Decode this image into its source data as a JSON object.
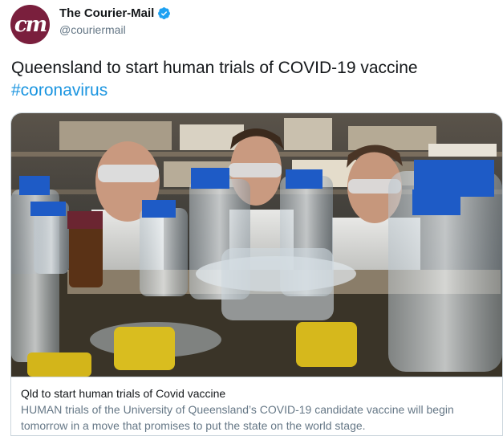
{
  "author": {
    "avatar_text": "cm",
    "display_name": "The Courier-Mail",
    "handle": "@couriermail",
    "verified": true
  },
  "tweet": {
    "text": "Queensland to start human trials of COVID-19 vaccine",
    "hashtag": "#coronavirus"
  },
  "card": {
    "title": "Qld to start human trials of Covid vaccine",
    "description": "HUMAN trials of the University of Queensland’s COVID-19 candidate vaccine will begin tomorrow in a move that promises to put the state on the world stage."
  },
  "colors": {
    "link": "#1b95e0",
    "avatar_bg": "#7a1f3d",
    "verified": "#1da1f2",
    "secondary_text": "#657786",
    "border": "#ccd6dd"
  }
}
